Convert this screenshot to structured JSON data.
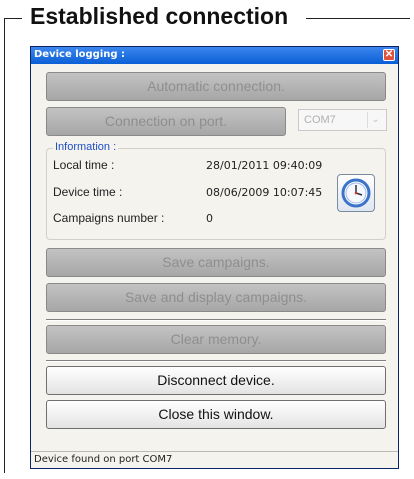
{
  "annotation": {
    "title": "Established connection"
  },
  "window": {
    "title": "Device logging :",
    "close_label": "✕"
  },
  "buttons": {
    "auto_connection": "Automatic connection.",
    "connection_on_port": "Connection on port.",
    "save_campaigns": "Save campaigns.",
    "save_display_campaigns": "Save and display campaigns.",
    "clear_memory": "Clear memory.",
    "disconnect_device": "Disconnect device.",
    "close_window": "Close this window."
  },
  "port_select": {
    "value": "COM7",
    "arrow": "⌄"
  },
  "information": {
    "legend": "Information :",
    "rows": [
      {
        "label": "Local time :",
        "value": "28/01/2011 09:40:09"
      },
      {
        "label": "Device time :",
        "value": "08/06/2009 10:07:45"
      },
      {
        "label": "Campaigns number :",
        "value": "0"
      }
    ]
  },
  "status": {
    "text": "Device found on port COM7"
  }
}
